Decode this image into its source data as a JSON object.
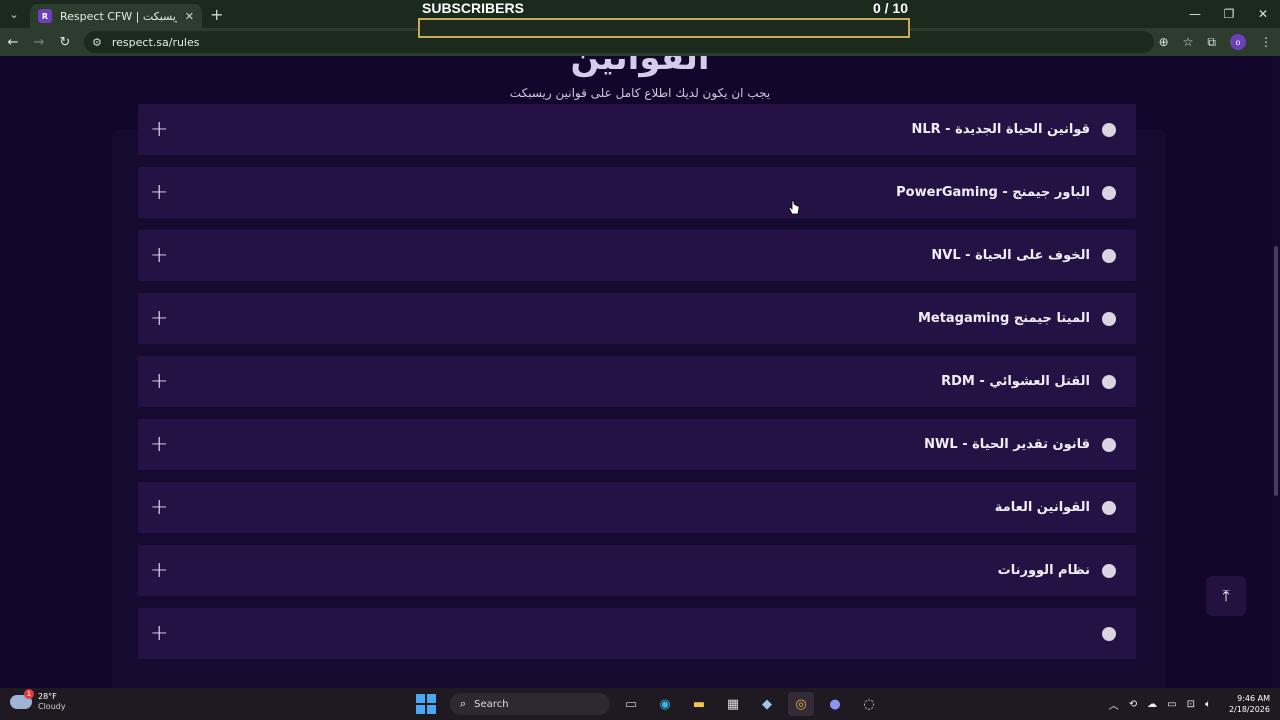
{
  "browser": {
    "tab_title": "Respect CFW | ريسبكت",
    "tab_favicon_letter": "R",
    "url": "respect.sa/rules",
    "profile_letter": "o"
  },
  "overlay": {
    "label": "SUBSCRIBERS",
    "count": "0  / 10",
    "progress": 0
  },
  "page": {
    "title": "القوانين",
    "subtitle": "يجب ان يكون لديك اطلاع كامل على قوانين ريسبكت",
    "rules": [
      {
        "label": "قوانين الحياة الجديدة - NLR"
      },
      {
        "label": "الباور جيمنج - PowerGaming"
      },
      {
        "label": "الخوف على الحياة - NVL"
      },
      {
        "label": "الميتا جيمنج Metagaming"
      },
      {
        "label": "القتل العشوائي - RDM"
      },
      {
        "label": "قانون تقدير الحياة - NWL"
      },
      {
        "label": "القوانين العامة"
      },
      {
        "label": "نظام الوورنات"
      },
      {
        "label": ""
      }
    ]
  },
  "taskbar": {
    "weather_temp": "28°F",
    "weather_cond": "Cloudy",
    "weather_badge": "1",
    "search_label": "Search",
    "time": "9:46 AM",
    "date": "2/18/2026"
  },
  "colors": {
    "page_bg": "#12062a",
    "rule_bg": "#251245",
    "accent_gold": "#c9a95a"
  }
}
